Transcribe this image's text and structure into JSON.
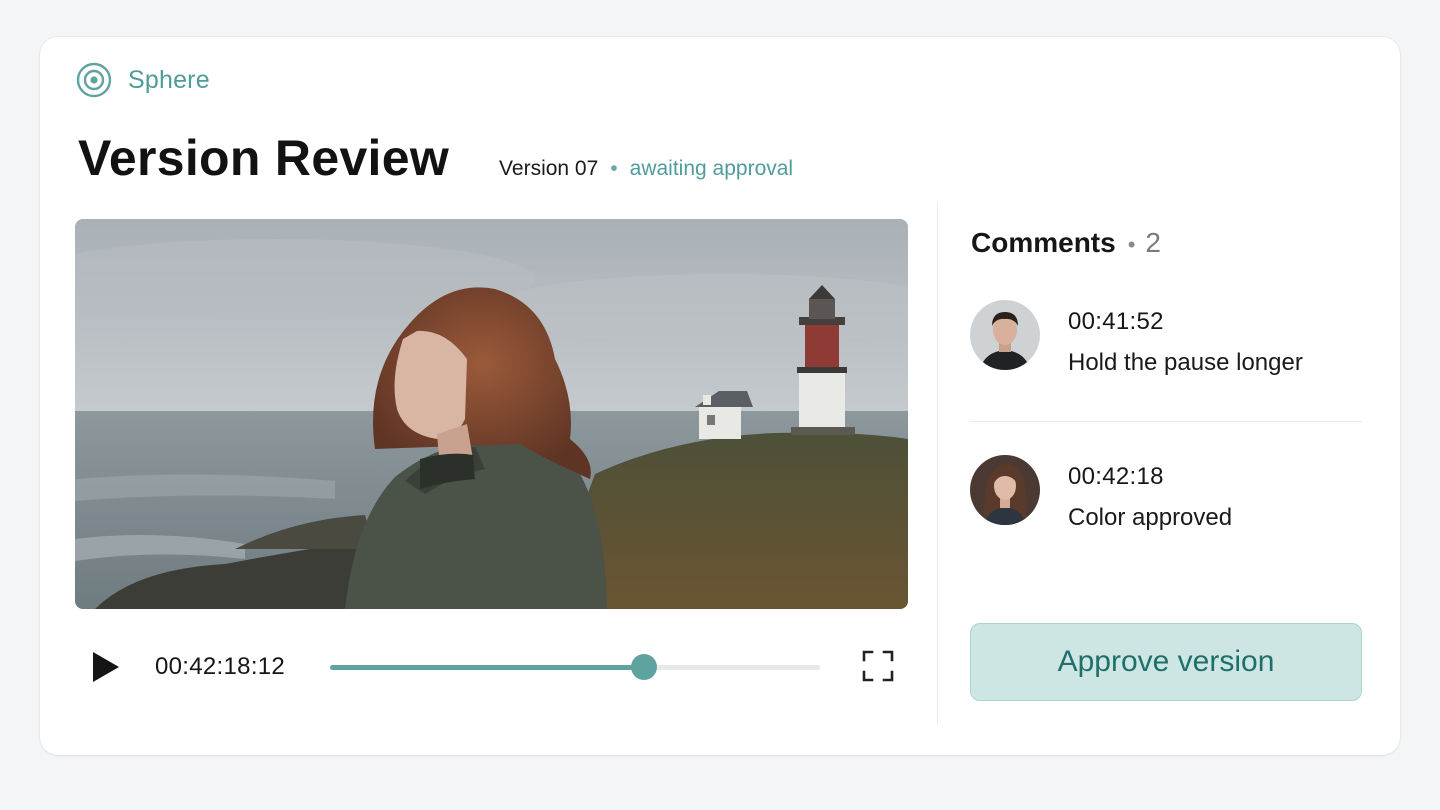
{
  "brand": {
    "name": "Sphere",
    "icon": "target-icon",
    "color": "#4f9c9a"
  },
  "header": {
    "title": "Version Review",
    "version": "Version 07",
    "separator": "•",
    "status": "awaiting approval"
  },
  "player": {
    "image": "woman-on-coast-with-lighthouse",
    "timecode": "00:42:18:12",
    "progress": 0.64,
    "play_icon": "play-icon",
    "fullscreen_icon": "fullscreen-icon"
  },
  "comments": {
    "title": "Comments",
    "separator": "•",
    "count": "2",
    "items": [
      {
        "time": "00:41:52",
        "text": "Hold the pause longer",
        "avatar": "avatar-man"
      },
      {
        "time": "00:42:18",
        "text": "Color approved",
        "avatar": "avatar-woman"
      }
    ]
  },
  "actions": {
    "approve_label": "Approve version"
  },
  "colors": {
    "accent": "#5fa3a0",
    "approve_bg": "#cde6e3",
    "approve_text": "#1f6f6a"
  }
}
